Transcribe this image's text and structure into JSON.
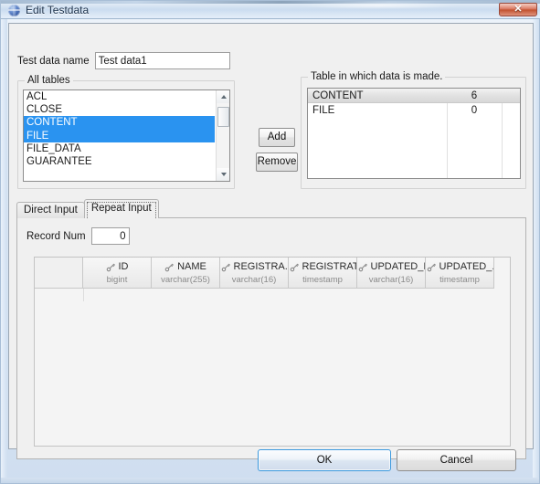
{
  "window": {
    "title": "Edit Testdata",
    "app_icon": "sphere-icon",
    "close_label": "✕",
    "accent_color": "#2a93f0",
    "focus_border_color": "#3c99dd",
    "close_button_color": "#c1512f"
  },
  "form": {
    "test_data_name_label": "Test data name",
    "test_data_name_value": "Test data1",
    "test_data_name_placeholder": ""
  },
  "all_tables": {
    "group_title": "All tables",
    "items": [
      {
        "label": "ACL",
        "selected": false
      },
      {
        "label": "CLOSE",
        "selected": false
      },
      {
        "label": "CONTENT",
        "selected": true
      },
      {
        "label": "FILE",
        "selected": true
      },
      {
        "label": "FILE_DATA",
        "selected": false
      },
      {
        "label": "GUARANTEE",
        "selected": false
      }
    ],
    "scrollbar": {
      "up_arrow": "chevron-up-icon",
      "down_arrow": "chevron-down-icon"
    }
  },
  "transfer_buttons": {
    "add_label": "Add",
    "remove_label": "Remove"
  },
  "made_tables": {
    "group_title": "Table in which data is made.",
    "rows": [
      {
        "name": "CONTENT",
        "count": "6",
        "highlighted": true
      },
      {
        "name": "FILE",
        "count": "0",
        "highlighted": false
      }
    ]
  },
  "tabs": [
    {
      "label": "Direct Input",
      "active": false
    },
    {
      "label": "Repeat Input",
      "active": true
    }
  ],
  "repeat_input": {
    "record_num_label": "Record Num",
    "record_num_value": "0",
    "record_num_placeholder": ""
  },
  "datagrid": {
    "row_header_label": "",
    "columns": [
      {
        "name": "ID",
        "type": "bigint",
        "icon": "key-icon"
      },
      {
        "name": "NAME",
        "type": "varchar(255)",
        "icon": "key-icon"
      },
      {
        "name": "REGISTRA...",
        "type": "varchar(16)",
        "icon": "key-icon"
      },
      {
        "name": "REGISTRAT...",
        "type": "timestamp",
        "icon": "key-icon"
      },
      {
        "name": "UPDATED_ID",
        "type": "varchar(16)",
        "icon": "key-icon"
      },
      {
        "name": "UPDATED_...",
        "type": "timestamp",
        "icon": "key-icon"
      }
    ],
    "rows": []
  },
  "footer": {
    "ok_label": "OK",
    "cancel_label": "Cancel"
  }
}
